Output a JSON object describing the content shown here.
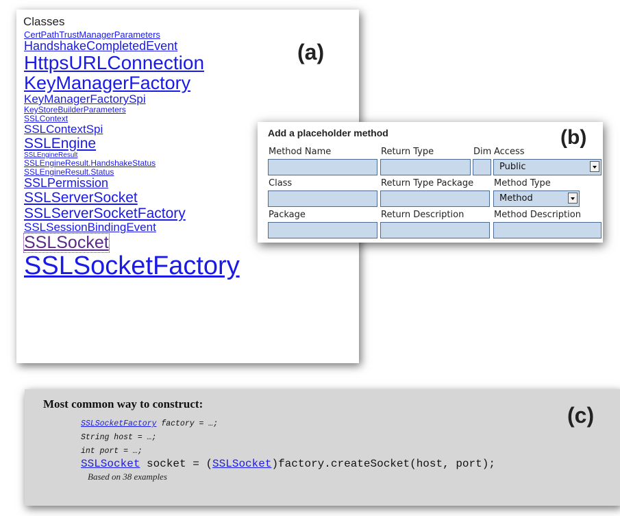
{
  "panel_a": {
    "heading": "Classes",
    "label": "(a)",
    "classes": [
      {
        "name": "CertPathTrustManagerParameters",
        "size": 13
      },
      {
        "name": "HandshakeCompletedEvent",
        "size": 18
      },
      {
        "name": "HttpsURLConnection",
        "size": 28
      },
      {
        "name": "KeyManagerFactory",
        "size": 27
      },
      {
        "name": "KeyManagerFactorySpi",
        "size": 17
      },
      {
        "name": "KeyStoreBuilderParameters",
        "size": 12
      },
      {
        "name": "SSLContext",
        "size": 12
      },
      {
        "name": "SSLContextSpi",
        "size": 17
      },
      {
        "name": "SSLEngine",
        "size": 21
      },
      {
        "name": "SSLEngineResult",
        "size": 10
      },
      {
        "name": "SSLEngineResult.HandshakeStatus",
        "size": 12
      },
      {
        "name": "SSLEngineResult.Status",
        "size": 12
      },
      {
        "name": "SSLPermission",
        "size": 18
      },
      {
        "name": "SSLServerSocket",
        "size": 21
      },
      {
        "name": "SSLServerSocketFactory",
        "size": 21
      },
      {
        "name": "SSLSessionBindingEvent",
        "size": 17
      },
      {
        "name": "SSLSocket",
        "size": 25,
        "state": "visited-focused"
      },
      {
        "name": "SSLSocketFactory",
        "size": 38
      }
    ]
  },
  "panel_b": {
    "label": "(b)",
    "title": "Add a placeholder method",
    "fields": {
      "method_name": "Method Name",
      "return_type": "Return Type",
      "dim": "Dim",
      "access": "Access",
      "access_value": "Public",
      "class": "Class",
      "return_type_package": "Return Type Package",
      "method_type": "Method Type",
      "method_type_value": "Method",
      "package": "Package",
      "return_description": "Return Description",
      "method_description": "Method Description"
    }
  },
  "panel_c": {
    "label": "(c)",
    "title": "Most common way to construct:",
    "line1_link": "SSLSocketFactory",
    "line1_rest": " factory = …;",
    "line2": "String host = …;",
    "line3": "int port = …;",
    "line4_link1": "SSLSocket",
    "line4_mid": " socket = (",
    "line4_link2": "SSLSocket",
    "line4_rest": ")factory.createSocket(host, port);",
    "note": "Based on 38 examples"
  },
  "colors": {
    "link": "#1a1ae6",
    "visited_link": "#5b2a86",
    "field_fill": "#c9d9ec",
    "code_panel_bg": "#d6d6d6"
  }
}
